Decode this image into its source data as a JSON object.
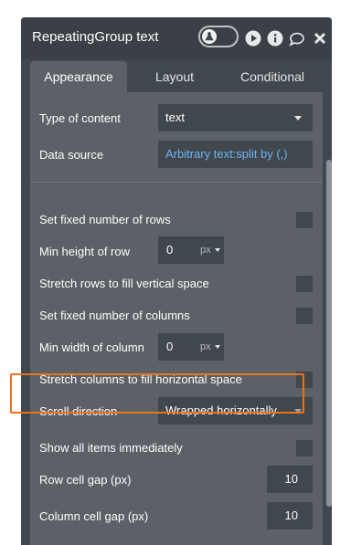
{
  "header": {
    "title": "RepeatingGroup text",
    "icons": [
      "debug-toggle-icon",
      "play-icon",
      "info-icon",
      "comment-icon",
      "close-icon"
    ]
  },
  "tabs": [
    {
      "label": "Appearance",
      "active": true
    },
    {
      "label": "Layout",
      "active": false
    },
    {
      "label": "Conditional",
      "active": false
    }
  ],
  "fields": {
    "type_of_content": {
      "label": "Type of content",
      "value": "text"
    },
    "data_source": {
      "label": "Data source",
      "value": "Arbitrary text:split by (,)"
    },
    "set_fixed_rows": {
      "label": "Set fixed number of rows",
      "checked": false
    },
    "min_height_row": {
      "label": "Min height of row",
      "value": "0",
      "unit": "px"
    },
    "stretch_rows": {
      "label": "Stretch rows to fill vertical space",
      "checked": false
    },
    "set_fixed_columns": {
      "label": "Set fixed number of columns",
      "checked": false
    },
    "min_width_column": {
      "label": "Min width of column",
      "value": "0",
      "unit": "px"
    },
    "stretch_columns": {
      "label": "Stretch columns to fill horizontal space",
      "checked": false
    },
    "scroll_direction": {
      "label": "Scroll direction",
      "value": "Wrapped horizontally"
    },
    "show_all_items": {
      "label": "Show all items immediately",
      "checked": false
    },
    "row_cell_gap": {
      "label": "Row cell gap (px)",
      "value": "10"
    },
    "column_cell_gap": {
      "label": "Column cell gap (px)",
      "value": "10"
    }
  },
  "colors": {
    "panel_bg": "#40474d",
    "content_bg": "#5b6167",
    "link_blue": "#6fb4f2",
    "highlight_orange": "#e8741f"
  }
}
